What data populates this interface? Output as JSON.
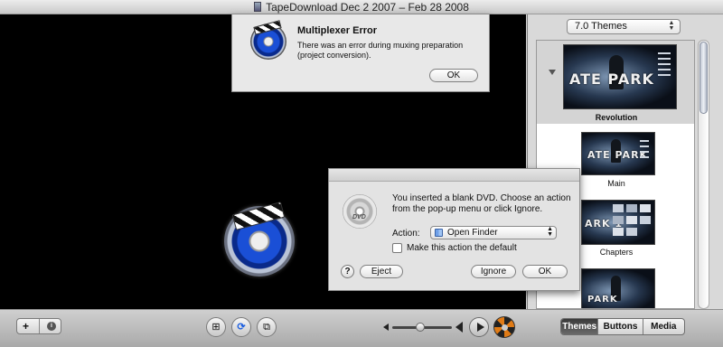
{
  "window": {
    "title": "TapeDownload Dec 2 2007 – Feb 28 2008"
  },
  "themes_panel": {
    "selector_value": "7.0 Themes",
    "items": [
      {
        "label": "Revolution",
        "thumb_text": "ATE PARK",
        "selected": true
      },
      {
        "label": "Main",
        "thumb_text": "ATE PARK"
      },
      {
        "label": "Chapters",
        "thumb_text": "ARK 1"
      },
      {
        "label": "",
        "thumb_text": "PARK"
      }
    ]
  },
  "alert_multiplexer": {
    "title": "Multiplexer Error",
    "message": "There was an error during muxing preparation (project conversion).",
    "ok_label": "OK"
  },
  "alert_blank_dvd": {
    "message": "You inserted a blank DVD. Choose an action from the pop-up menu or click Ignore.",
    "action_label": "Action:",
    "action_value": "Open Finder",
    "checkbox_label": "Make this action the default",
    "checkbox_checked": false,
    "help_label": "?",
    "eject_label": "Eject",
    "ignore_label": "Ignore",
    "ok_label": "OK",
    "icon_text": "DVD"
  },
  "toolbar": {
    "add_label": "+",
    "info_label": "i",
    "segments": [
      {
        "label": "Themes",
        "active": true
      },
      {
        "label": "Buttons",
        "active": false
      },
      {
        "label": "Media",
        "active": false
      }
    ]
  }
}
